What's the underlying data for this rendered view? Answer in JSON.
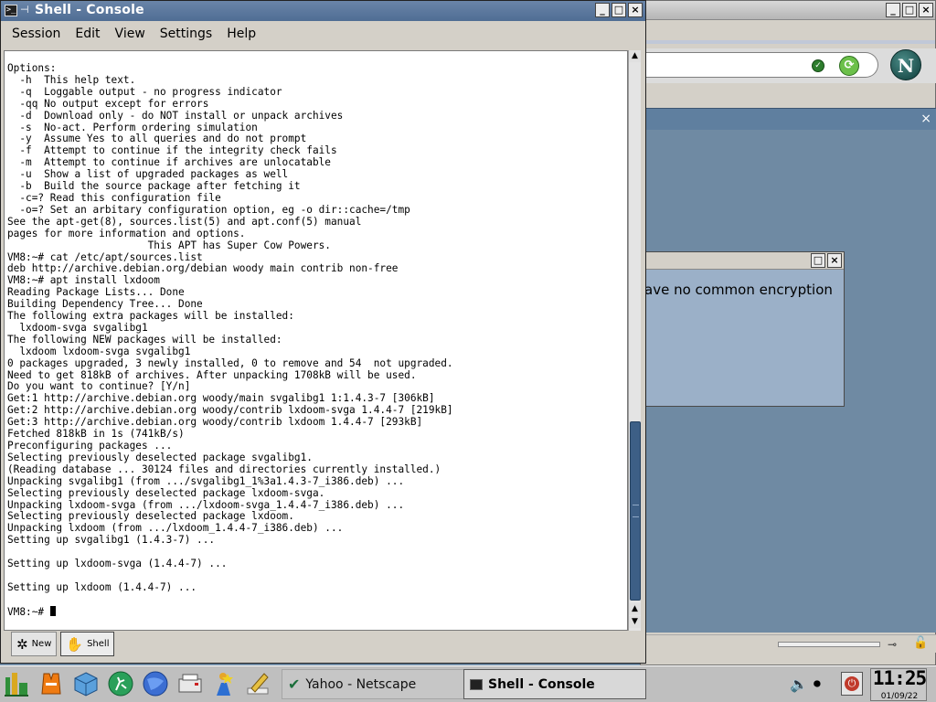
{
  "background_window": {
    "title_buttons": [
      "_",
      "□",
      "×"
    ],
    "sidebar_close": "×",
    "netscape_logo": "N",
    "url_check": "✓",
    "url_go": "⟳"
  },
  "dialog": {
    "message": "ave no common encryption",
    "title_buttons": [
      "□",
      "×"
    ]
  },
  "shell": {
    "title": "Shell - Console",
    "title_buttons": [
      "_",
      "□",
      "×"
    ],
    "menu": [
      "Session",
      "Edit",
      "View",
      "Settings",
      "Help"
    ],
    "terminal_lines": [
      "Options:",
      "  -h  This help text.",
      "  -q  Loggable output - no progress indicator",
      "  -qq No output except for errors",
      "  -d  Download only - do NOT install or unpack archives",
      "  -s  No-act. Perform ordering simulation",
      "  -y  Assume Yes to all queries and do not prompt",
      "  -f  Attempt to continue if the integrity check fails",
      "  -m  Attempt to continue if archives are unlocatable",
      "  -u  Show a list of upgraded packages as well",
      "  -b  Build the source package after fetching it",
      "  -c=? Read this configuration file",
      "  -o=? Set an arbitary configuration option, eg -o dir::cache=/tmp",
      "See the apt-get(8), sources.list(5) and apt.conf(5) manual",
      "pages for more information and options.",
      "                       This APT has Super Cow Powers.",
      "VM8:~# cat /etc/apt/sources.list",
      "deb http://archive.debian.org/debian woody main contrib non-free",
      "VM8:~# apt install lxdoom",
      "Reading Package Lists... Done",
      "Building Dependency Tree... Done",
      "The following extra packages will be installed:",
      "  lxdoom-svga svgalibg1",
      "The following NEW packages will be installed:",
      "  lxdoom lxdoom-svga svgalibg1",
      "0 packages upgraded, 3 newly installed, 0 to remove and 54  not upgraded.",
      "Need to get 818kB of archives. After unpacking 1708kB will be used.",
      "Do you want to continue? [Y/n]",
      "Get:1 http://archive.debian.org woody/main svgalibg1 1:1.4.3-7 [306kB]",
      "Get:2 http://archive.debian.org woody/contrib lxdoom-svga 1.4.4-7 [219kB]",
      "Get:3 http://archive.debian.org woody/contrib lxdoom 1.4.4-7 [293kB]",
      "Fetched 818kB in 1s (741kB/s)",
      "Preconfiguring packages ...",
      "Selecting previously deselected package svgalibg1.",
      "(Reading database ... 30124 files and directories currently installed.)",
      "Unpacking svgalibg1 (from .../svgalibg1_1%3a1.4.3-7_i386.deb) ...",
      "Selecting previously deselected package lxdoom-svga.",
      "Unpacking lxdoom-svga (from .../lxdoom-svga_1.4.4-7_i386.deb) ...",
      "Selecting previously deselected package lxdoom.",
      "Unpacking lxdoom (from .../lxdoom_1.4.4-7_i386.deb) ...",
      "Setting up svgalibg1 (1.4.3-7) ...",
      "",
      "Setting up lxdoom-svga (1.4.4-7) ...",
      "",
      "Setting up lxdoom (1.4.4-7) ...",
      ""
    ],
    "prompt": "VM8:~# ",
    "tabs": [
      {
        "label": "New",
        "icon": "new-session-icon"
      },
      {
        "label": "Shell",
        "icon": "shell-icon"
      }
    ]
  },
  "panel": {
    "tasks": [
      {
        "label": "Yahoo - Netscape",
        "icon": "netscape-icon",
        "active": false
      },
      {
        "label": "Shell - Console",
        "icon": "konsole-icon",
        "active": true
      }
    ],
    "clock": {
      "time": "11:25",
      "date": "01/09/22"
    }
  },
  "colors": {
    "title_active": "#4f6d94",
    "scroll_thumb": "#3d5f86",
    "desktop": "#6f8aa3"
  }
}
